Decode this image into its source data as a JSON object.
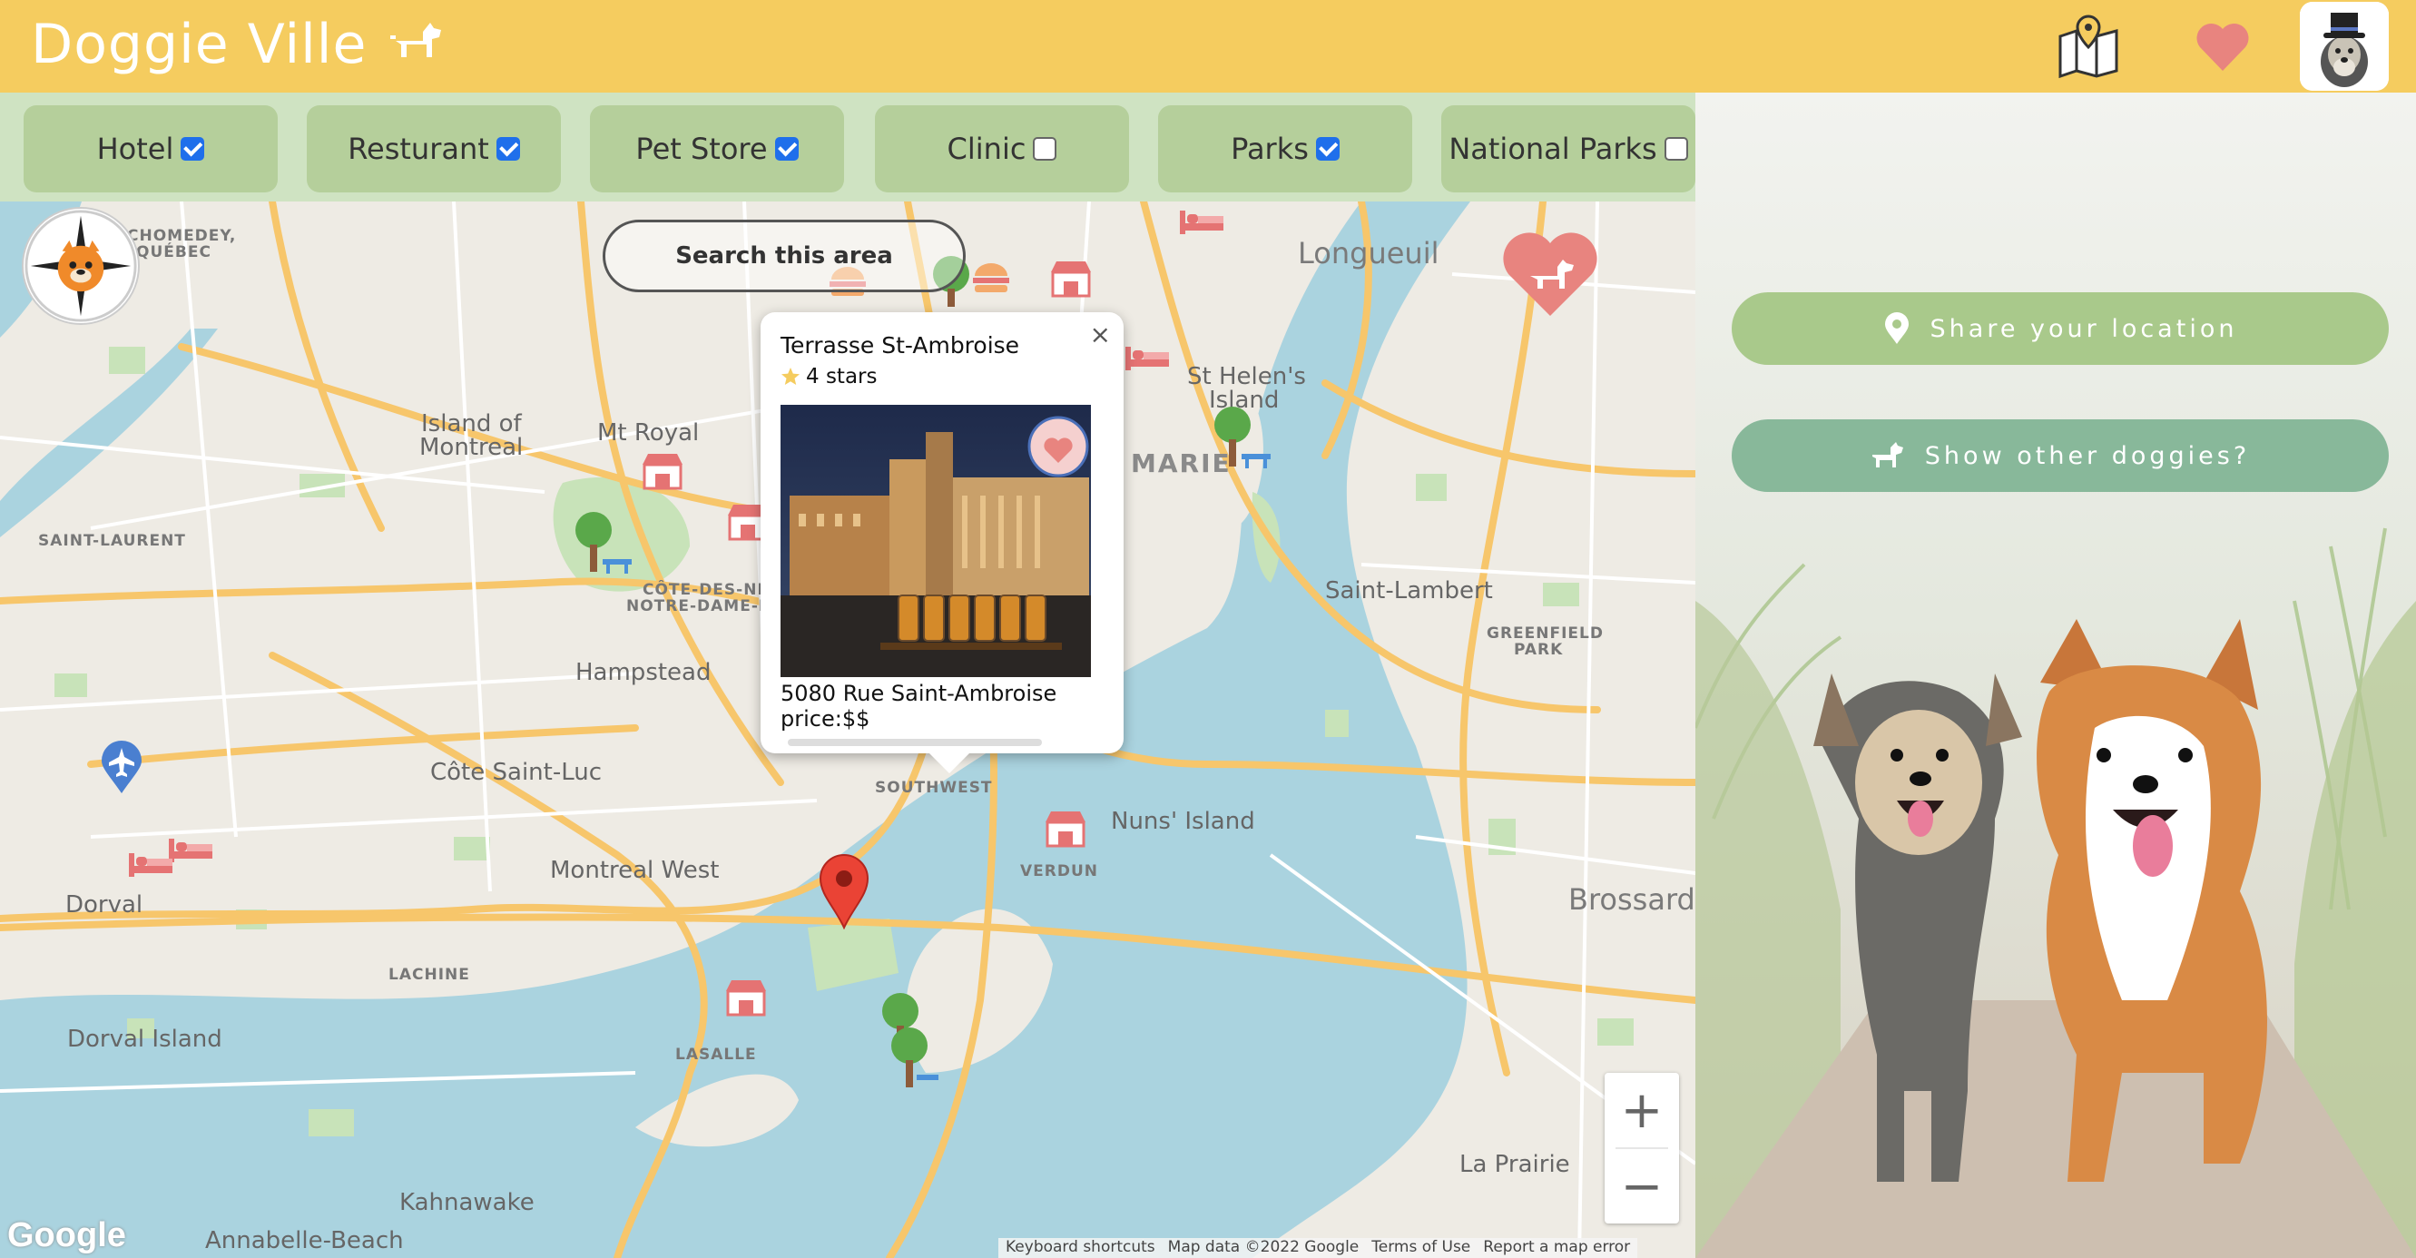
{
  "app": {
    "title": "Doggie Ville",
    "icons": {
      "brand": "dog-icon",
      "map": "map-pin-icon",
      "favorites": "heart-icon",
      "avatar": "avatar-icon"
    },
    "colors": {
      "header": "#f5cc5f",
      "filter_bg": "#cfe3c2",
      "filter_button": "#b5cf9b",
      "accent_heart": "#e8847f",
      "share_button": "#a9c98b",
      "show_button": "#88b89a"
    }
  },
  "filters": [
    {
      "label": "Hotel",
      "checked": true
    },
    {
      "label": "Resturant",
      "checked": true
    },
    {
      "label": "Pet Store",
      "checked": true
    },
    {
      "label": "Clinic",
      "checked": false
    },
    {
      "label": "Parks",
      "checked": true
    },
    {
      "label": "National Parks",
      "checked": false
    }
  ],
  "map": {
    "search_area_label": "Search this area",
    "labels": {
      "chomedey": "CHOMEDEY,",
      "quebec": "QUÉBEC",
      "longueuil": "Longueuil",
      "island_of": "Island of",
      "montreal": "Montreal",
      "mt_royal": "Mt Royal",
      "st_helens": "St Helen's",
      "island": "Island",
      "marie": "MARIE",
      "saint_laurent": "SAINT-LAURENT",
      "cote_des_neiges": "CÔTE-DES-NEIG",
      "notre_dame": "NOTRE-DAME-DE-",
      "saint_lambert": "Saint-Lambert",
      "greenfield": "GREENFIELD",
      "park": "PARK",
      "hampstead": "Hampstead",
      "cote_saint_luc": "Côte Saint-Luc",
      "southwest": "SOUTHWEST",
      "nuns_island": "Nuns' Island",
      "montreal_west": "Montreal West",
      "verdun": "VERDUN",
      "dorval": "Dorval",
      "brossard": "Brossard",
      "lachine": "LACHINE",
      "dorval_island": "Dorval Island",
      "lasalle": "LASALLE",
      "la_prairie": "La Prairie",
      "kahnawake": "Kahnawake",
      "annabelle_beach": "Annabelle-Beach"
    },
    "zoom_in": "+",
    "zoom_out": "−",
    "google_logo": "Google",
    "attribution": [
      "Keyboard shortcuts",
      "Map data ©2022 Google",
      "Terms of Use",
      "Report a map error"
    ]
  },
  "popup": {
    "title": "Terrasse St-Ambroise",
    "stars": "4 stars",
    "address": "5080 Rue Saint-Ambroise",
    "price": "price:$$",
    "close": "×"
  },
  "side": {
    "share_label": "Share your location",
    "show_label": "Show other doggies?"
  }
}
